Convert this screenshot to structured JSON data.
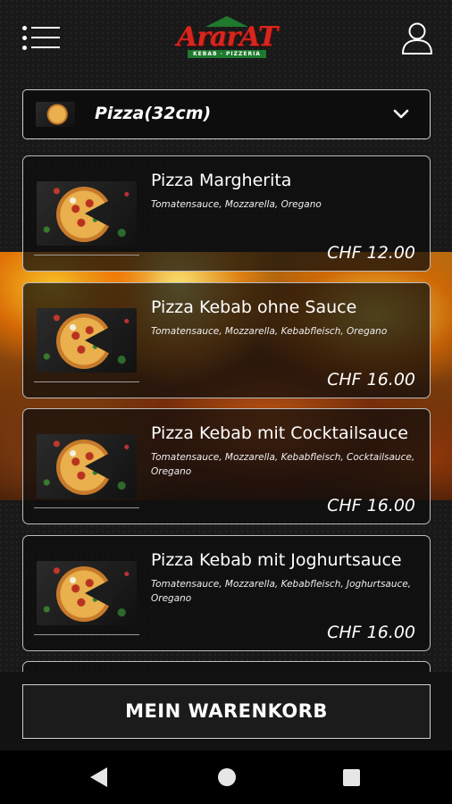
{
  "header": {
    "menu_icon": "menu-icon",
    "logo_text": "ArarAT",
    "logo_subtitle": "KEBAB · PIZZERIA",
    "user_icon": "user-icon"
  },
  "category": {
    "selected": "Pizza(32cm)",
    "chevron_icon": "chevron-down-icon"
  },
  "products": [
    {
      "name": "Pizza Margherita",
      "description": "Tomatensauce, Mozzarella, Oregano",
      "price": "CHF 12.00"
    },
    {
      "name": "Pizza Kebab ohne Sauce",
      "description": "Tomatensauce, Mozzarella, Kebabfleisch, Oregano",
      "price": "CHF 16.00"
    },
    {
      "name": "Pizza Kebab mit Cocktailsauce",
      "description": "Tomatensauce, Mozzarella, Kebabfleisch, Cocktailsauce, Oregano",
      "price": "CHF 16.00"
    },
    {
      "name": "Pizza Kebab mit Joghurtsauce",
      "description": "Tomatensauce, Mozzarella, Kebabfleisch, Joghurtsauce, Oregano",
      "price": "CHF 16.00"
    }
  ],
  "cart": {
    "button_label": "MEIN WARENKORB"
  },
  "colors": {
    "brand_red": "#d8261f",
    "brand_green": "#1f7a2e",
    "background": "#191919"
  },
  "system_nav": {
    "back_icon": "back-icon",
    "home_icon": "home-icon",
    "recent_icon": "recent-apps-icon"
  }
}
